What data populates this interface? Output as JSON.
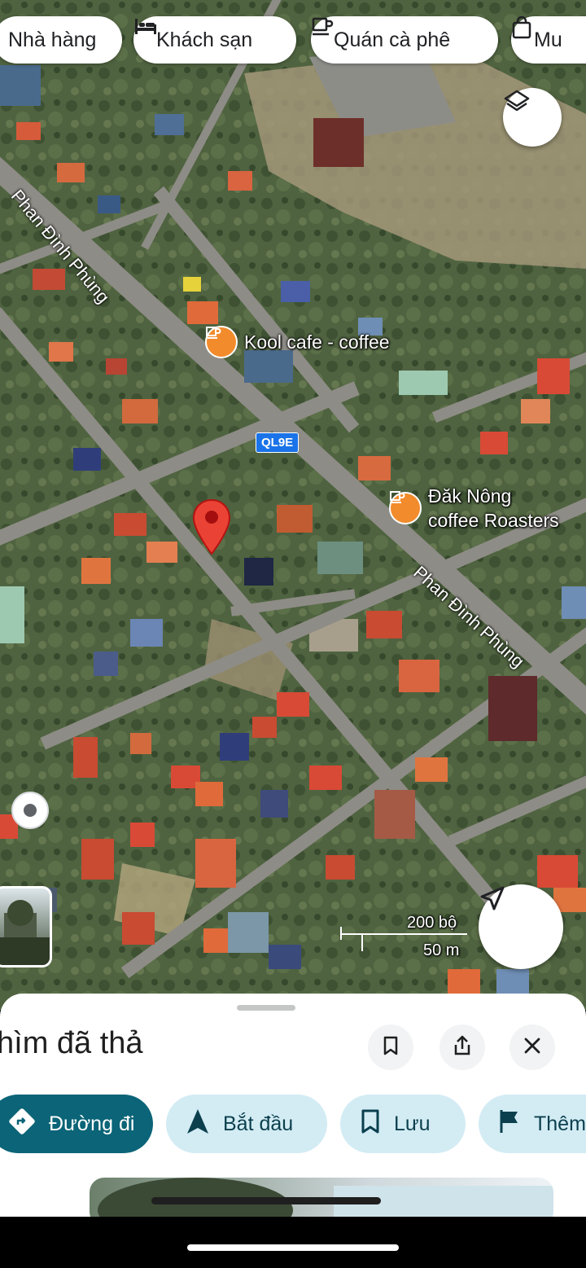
{
  "chips": [
    {
      "label": "Nhà hàng",
      "icon": "fork-knife-icon"
    },
    {
      "label": "Khách sạn",
      "icon": "bed-icon"
    },
    {
      "label": "Quán cà phê",
      "icon": "coffee-cup-icon"
    },
    {
      "label": "Mu",
      "icon": "shopping-bag-icon"
    }
  ],
  "map": {
    "highway_shield": "QL9E",
    "road_label_1": "Phan Đình Phùng",
    "road_label_2": "Phan Đình Phùng",
    "poi_1": "Kool cafe - coffee",
    "poi_2_line1": "Đăk Nông",
    "poi_2_line2": "coffee Roasters",
    "scale_top": "200 bộ",
    "scale_bottom": "50 m",
    "colors": {
      "poi": "#f28b2c",
      "pin": "#ea4335",
      "highway": "#1a73e8"
    }
  },
  "sheet": {
    "title": "hìm đã thả",
    "actions": [
      {
        "label": "Đường đi",
        "icon": "directions-icon"
      },
      {
        "label": "Bắt đầu",
        "icon": "navigation-arrow-icon"
      },
      {
        "label": "Lưu",
        "icon": "bookmark-icon"
      },
      {
        "label": "Thêm",
        "icon": "flag-icon"
      }
    ],
    "colors": {
      "primary": "#0b6477",
      "secondary": "#d3ecf4"
    }
  }
}
